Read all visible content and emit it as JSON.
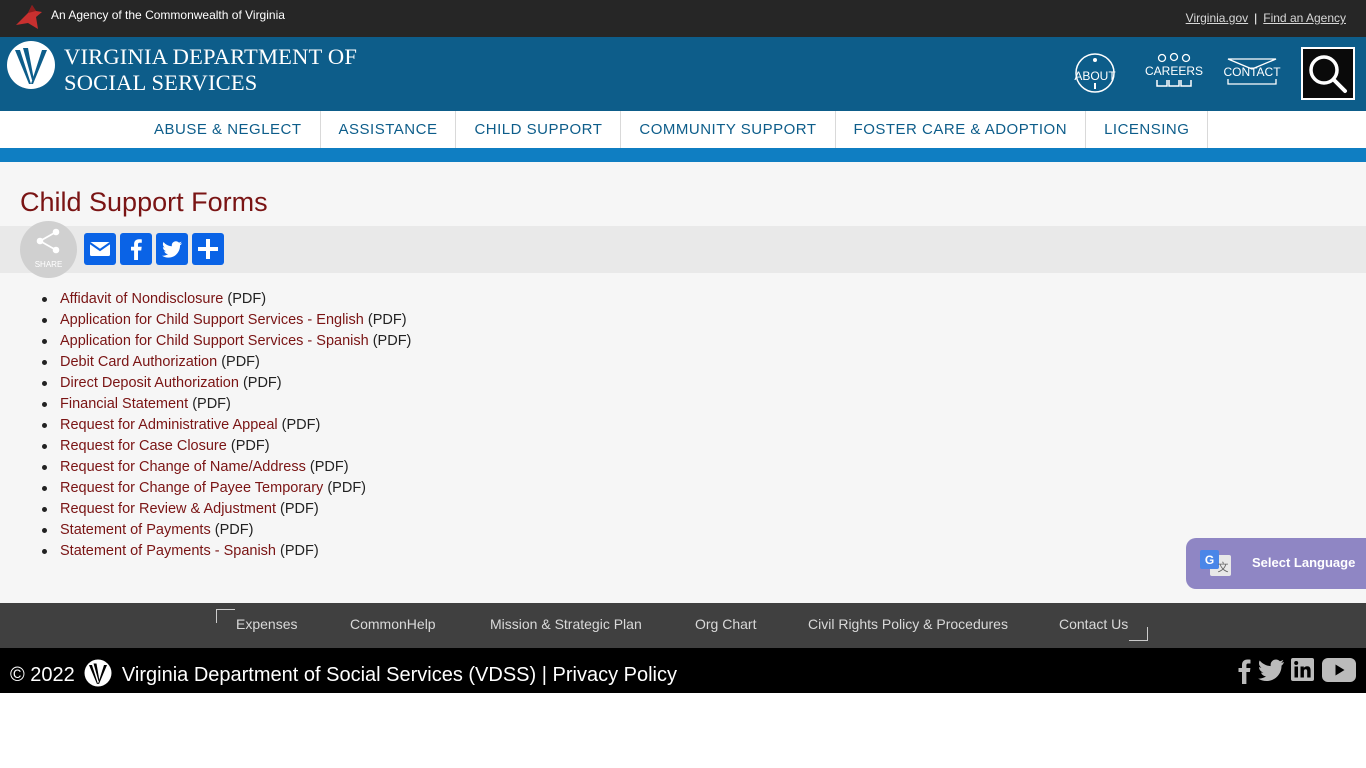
{
  "agency_bar": {
    "agency_text": "An Agency of the Commonwealth of Virginia",
    "virginia_gov": "Virginia.gov",
    "separator": "|",
    "find_agency": "Find an Agency"
  },
  "header": {
    "title_line1": "VIRGINIA DEPARTMENT OF",
    "title_line2": "SOCIAL SERVICES",
    "about": "ABOUT",
    "careers": "CAREERS",
    "contact": "CONTACT"
  },
  "nav": {
    "items": [
      {
        "label": "ABUSE & NEGLECT"
      },
      {
        "label": "ASSISTANCE"
      },
      {
        "label": "CHILD SUPPORT"
      },
      {
        "label": "COMMUNITY SUPPORT"
      },
      {
        "label": "FOSTER CARE & ADOPTION"
      },
      {
        "label": "LICENSING"
      }
    ]
  },
  "page": {
    "title": "Child Support Forms",
    "share_label": "SHARE"
  },
  "forms": [
    {
      "link": "Affidavit of Nondisclosure",
      "suffix": "(PDF)"
    },
    {
      "link": "Application for Child Support Services - English",
      "suffix": "(PDF)"
    },
    {
      "link": "Application for Child Support Services - Spanish",
      "suffix": "(PDF)"
    },
    {
      "link": "Debit Card Authorization",
      "suffix": "(PDF)"
    },
    {
      "link": "Direct Deposit Authorization",
      "suffix": "(PDF)"
    },
    {
      "link": "Financial Statement",
      "suffix": "(PDF)"
    },
    {
      "link": "Request for Administrative Appeal",
      "suffix": "(PDF)"
    },
    {
      "link": "Request for Case Closure",
      "suffix": "(PDF)"
    },
    {
      "link": "Request for Change of Name/Address",
      "suffix": "(PDF)"
    },
    {
      "link": "Request for Change of Payee Temporary",
      "suffix": "(PDF)"
    },
    {
      "link": "Request for Review & Adjustment",
      "suffix": "(PDF)"
    },
    {
      "link": "Statement of Payments",
      "suffix": "(PDF)"
    },
    {
      "link": "Statement of Payments - Spanish",
      "suffix": "(PDF)"
    }
  ],
  "translate": {
    "label": "Select Language"
  },
  "footer": {
    "links": [
      {
        "label": "Expenses"
      },
      {
        "label": "CommonHelp"
      },
      {
        "label": "Mission & Strategic Plan"
      },
      {
        "label": "Org Chart"
      },
      {
        "label": "Civil Rights Policy & Procedures"
      },
      {
        "label": "Contact Us"
      }
    ],
    "copyright_prefix": "© 2022",
    "agency_name": "Virginia Department of Social Services (VDSS)",
    "pipe": "|",
    "privacy": "Privacy Policy"
  },
  "colors": {
    "header_blue": "#0d5d8a",
    "stripe_blue": "#0f7ec2",
    "title_red": "#7a1414",
    "share_blue": "#0a63e6",
    "translate_purple": "#8f86c4"
  }
}
